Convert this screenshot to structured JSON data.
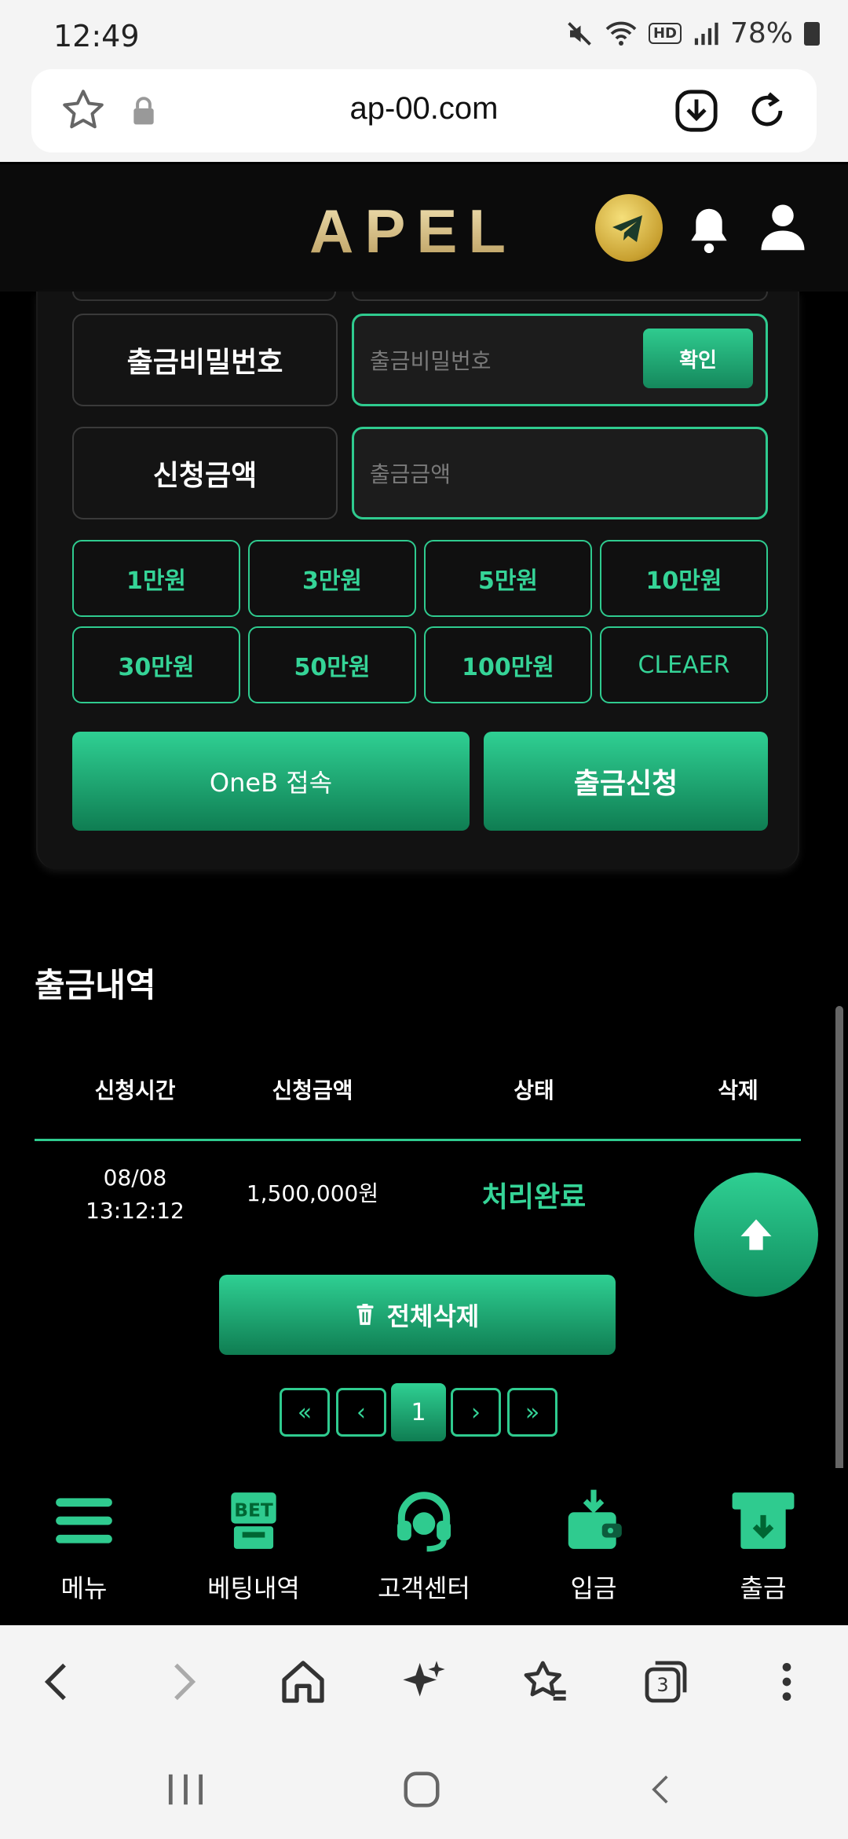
{
  "status_bar": {
    "time": "12:49",
    "hd": "HD",
    "battery": "78%"
  },
  "browser": {
    "url": "ap-00.com",
    "tabs_count": "3"
  },
  "site": {
    "logo_text": "APEL"
  },
  "form": {
    "password_label": "출금비밀번호",
    "password_placeholder": "출금비밀번호",
    "confirm_label": "확인",
    "amount_label": "신청금액",
    "amount_placeholder": "출금금액",
    "amount_buttons": [
      "1만원",
      "3만원",
      "5만원",
      "10만원",
      "30만원",
      "50만원",
      "100만원",
      "CLEAER"
    ],
    "oneb_label": "OneB 접속",
    "withdraw_label": "출금신청"
  },
  "history": {
    "title": "출금내역",
    "headers": [
      "신청시간",
      "신청금액",
      "상태",
      "삭제"
    ],
    "rows": [
      {
        "date": "08/08",
        "time": "13:12:12",
        "amount": "1,500,000원",
        "status": "처리완료"
      }
    ],
    "delete_all_label": "전체삭제",
    "pagination": {
      "first": "«",
      "prev": "‹",
      "current": "1",
      "next": "›",
      "last": "»"
    }
  },
  "bottom_nav": {
    "items": [
      {
        "label": "메뉴",
        "icon": "menu-icon"
      },
      {
        "label": "베팅내역",
        "icon": "bet-icon"
      },
      {
        "label": "고객센터",
        "icon": "headset-icon"
      },
      {
        "label": "입금",
        "icon": "wallet-icon"
      },
      {
        "label": "출금",
        "icon": "withdraw-icon"
      }
    ],
    "bet_icon_text": "BET"
  },
  "colors": {
    "accent": "#2fcb8f",
    "accent_dark": "#0f7d52",
    "gold": "#d8c48f",
    "background": "#000000"
  }
}
